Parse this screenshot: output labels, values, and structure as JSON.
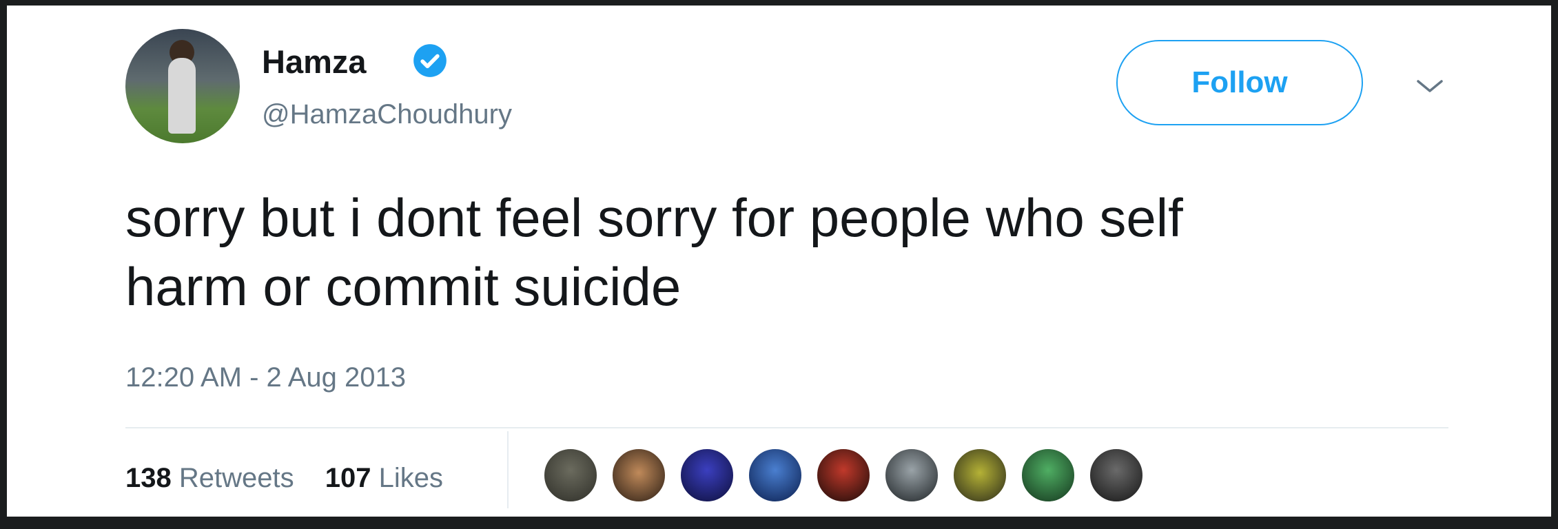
{
  "tweet": {
    "author": {
      "name": "Hamza",
      "handle": "@HamzaChoudhury",
      "verified": true,
      "avatar_icon": "profile-photo"
    },
    "follow_label": "Follow",
    "menu_icon": "chevron-down-icon",
    "text": "sorry but i dont feel sorry for people who self\nharm or commit suicide",
    "timestamp": "12:20 AM - 2 Aug 2013",
    "stats": {
      "retweets_count": "138",
      "retweets_label": "Retweets",
      "likes_count": "107",
      "likes_label": "Likes"
    },
    "likers_count_shown": 9
  },
  "colors": {
    "accent": "#1da1f2",
    "text_primary": "#14171a",
    "text_secondary": "#657786",
    "divider": "#e6ecf0",
    "background_frame": "#1b1d1e"
  }
}
